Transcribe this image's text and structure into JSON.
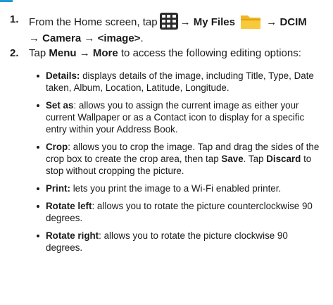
{
  "step1": {
    "number": "1.",
    "lead": "From the Home screen, tap",
    "arrow_a": "→",
    "my_files": "My Files",
    "arrow_b": "→",
    "dcim": "DCIM",
    "line2_arrow_a": "→",
    "camera": "Camera",
    "line2_arrow_b": "→",
    "image": "<image>",
    "period": "."
  },
  "step2": {
    "number": "2.",
    "tap": "Tap",
    "menu": "Menu",
    "arrow": "→",
    "more": "More",
    "rest": "to access the following editing options:"
  },
  "options": [
    {
      "term": "Details:",
      "desc": "displays details of the image, including Title, Type, Date taken, Album, Location, Latitude, Longitude."
    },
    {
      "term": "Set as",
      "desc": ": allows you to assign the current image as either your current Wallpaper or as a Contact icon to display for a specific entry within your Address Book."
    },
    {
      "term": "Crop",
      "desc_a": ": allows you to crop the image. Tap and drag the sides of the crop box to create the crop area, then tap",
      "save": "Save",
      "desc_b": ". Tap",
      "discard": "Discard",
      "desc_c": "to stop without cropping the picture."
    },
    {
      "term": "Print:",
      "desc": "lets you print the image to a Wi-Fi enabled printer."
    },
    {
      "term": "Rotate left",
      "desc": ": allows you to rotate the picture counterclockwise 90 degrees."
    },
    {
      "term": "Rotate right",
      "desc": ": allows you to rotate the picture clockwise 90 degrees."
    }
  ],
  "icons": {
    "apps": "apps-grid-icon",
    "my_files": "folder-icon"
  },
  "colors": {
    "accent": "#1e9ad6",
    "folder": "#f3b61f"
  }
}
